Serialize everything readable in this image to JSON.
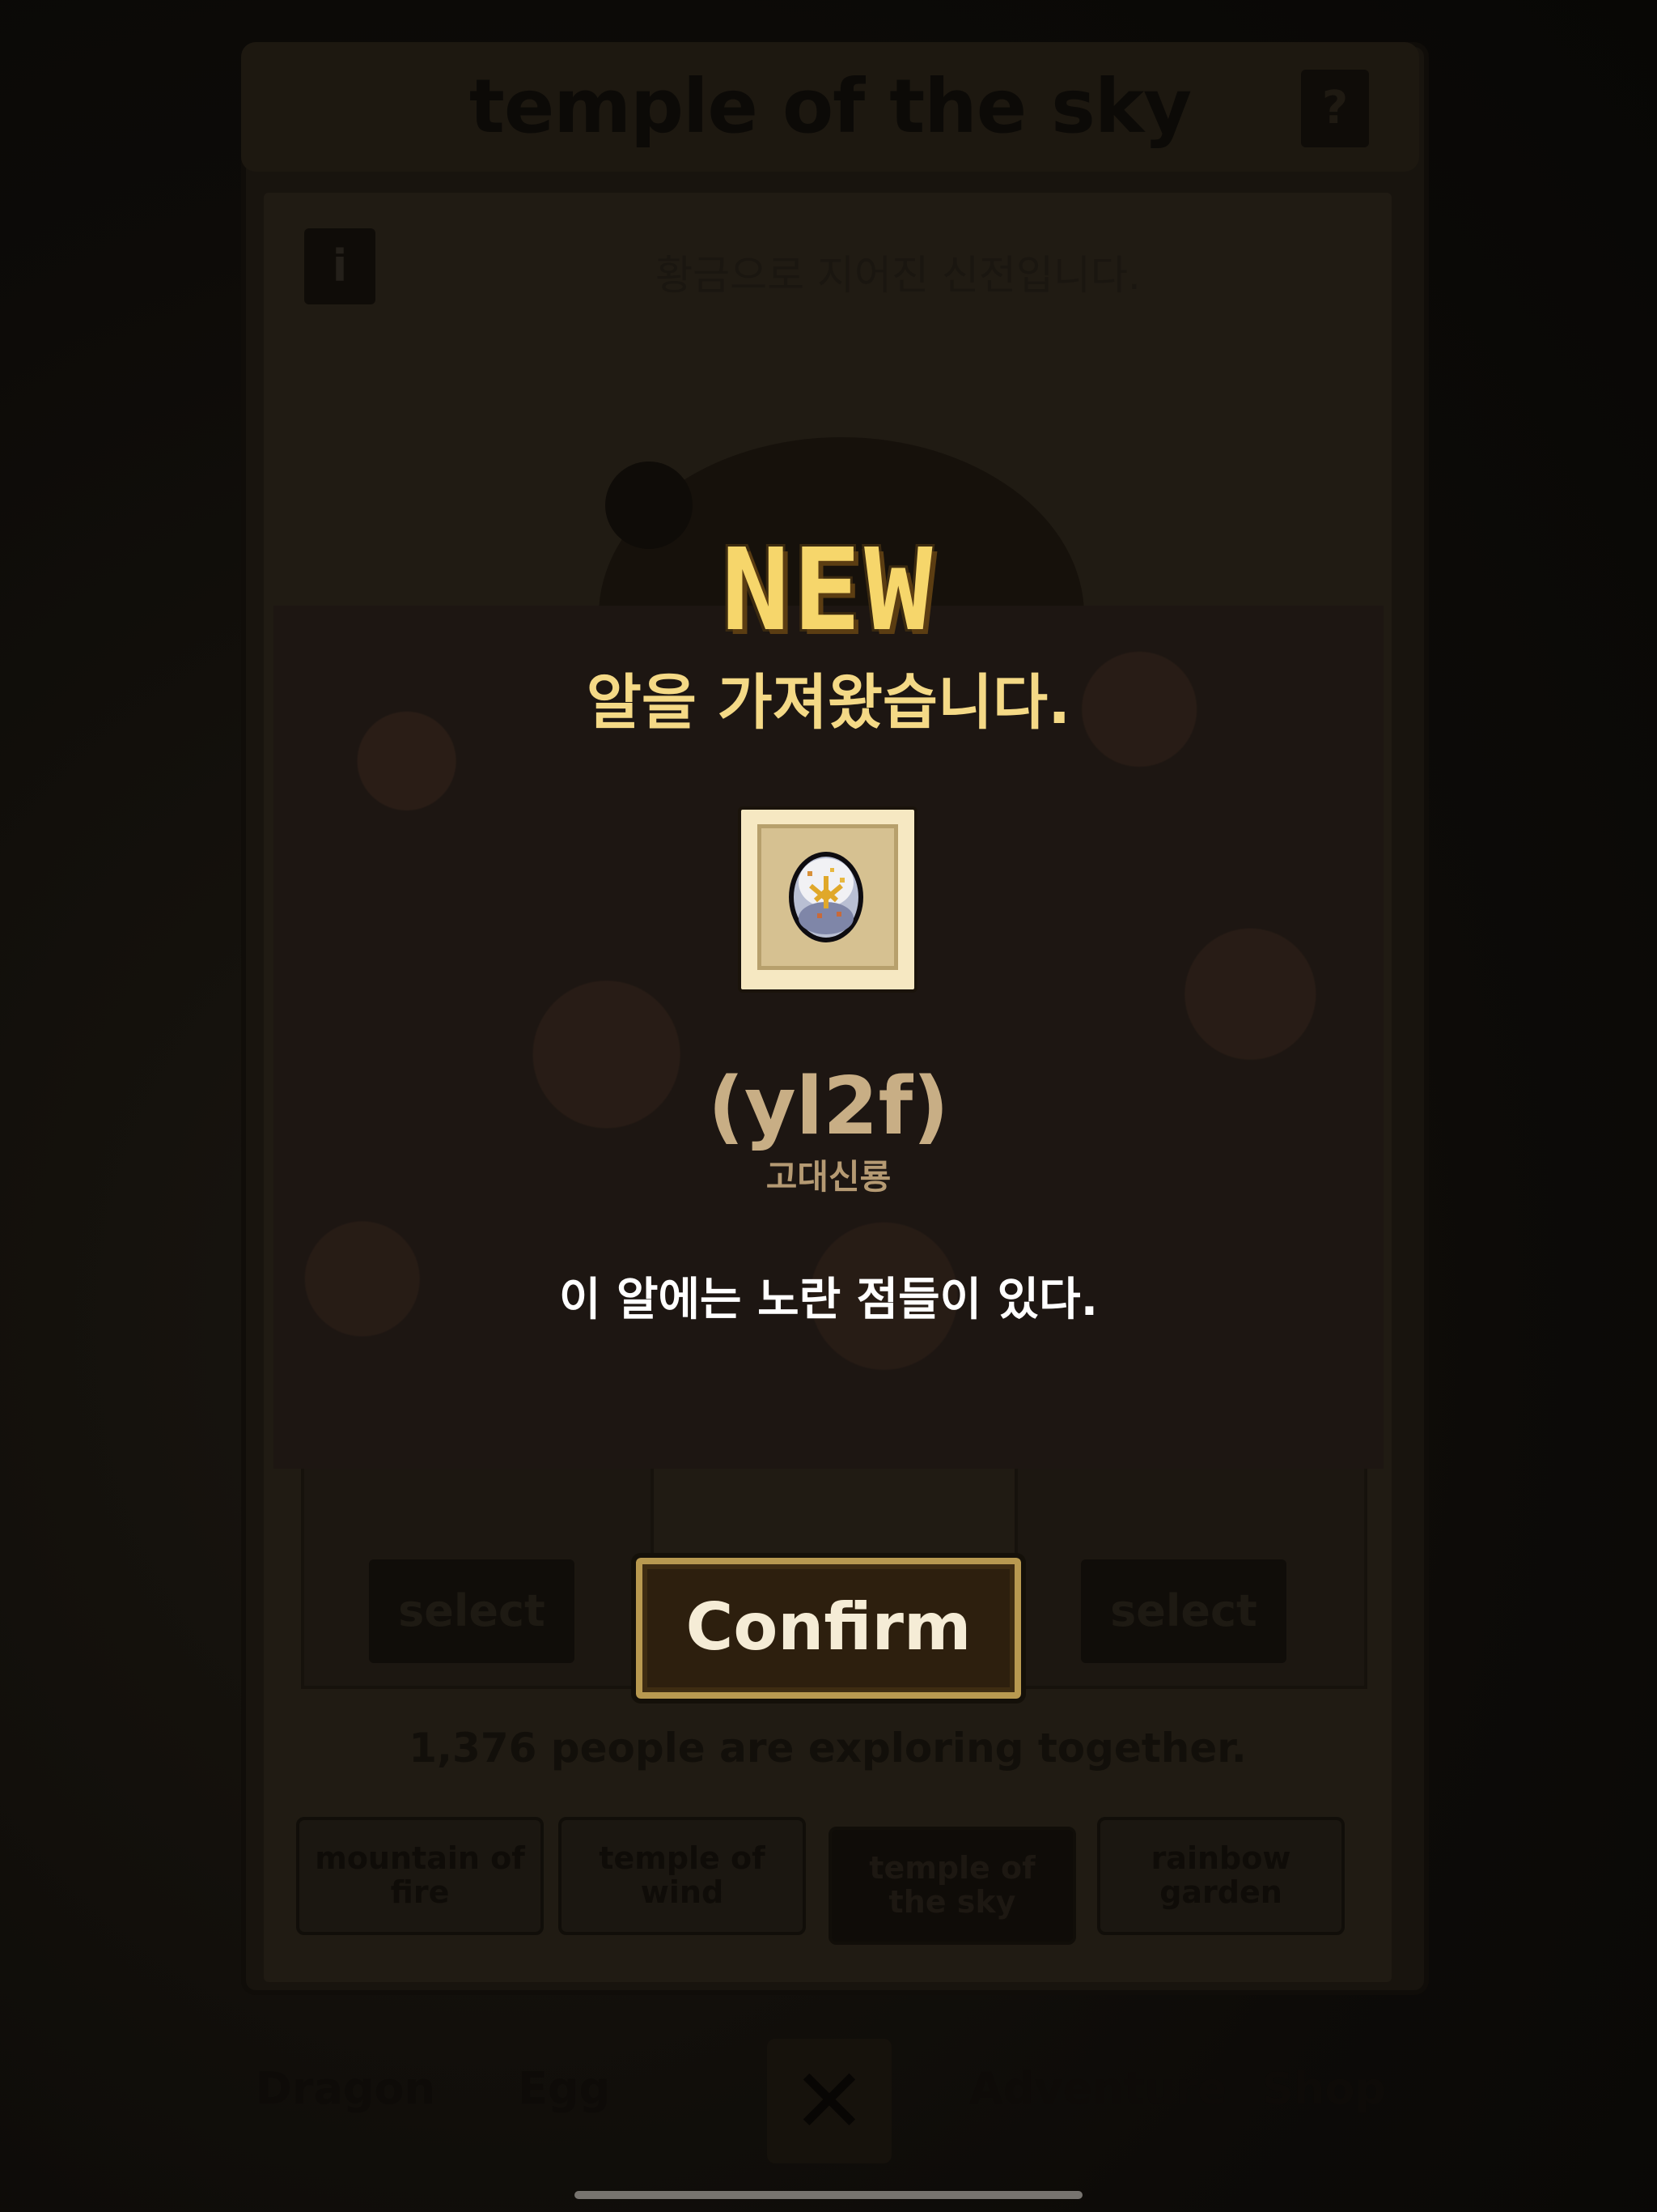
{
  "screen": {
    "title": "temple of the sky",
    "help_label": "?",
    "info_label": "i",
    "location_description": "황금으로 지어진 신전입니다.",
    "select_left": "select",
    "select_right": "select",
    "explore_text": "1,376 people are exploring together.",
    "tabs": [
      {
        "label": "mountain of fire"
      },
      {
        "label": "temple of wind"
      },
      {
        "label": "temple of the sky"
      },
      {
        "label": "rainbow garden"
      }
    ],
    "bottom_nav": [
      "Dragon",
      "Egg",
      "Adventure",
      "Shop"
    ],
    "close_icon": "close-icon"
  },
  "modal": {
    "badge": "NEW",
    "title": "알을 가져왔습니다.",
    "item": {
      "icon": "egg-icon",
      "name": "(yl2f)",
      "type": "고대신룡",
      "description": "이 알에는 노란 점들이 있다."
    },
    "confirm_label": "Confirm"
  },
  "colors": {
    "badge": "#f6d66b",
    "title": "#f4d986",
    "item_name": "#c8ae85",
    "modal_bg": "#1d1612",
    "confirm_bg": "#2d1f0e"
  }
}
